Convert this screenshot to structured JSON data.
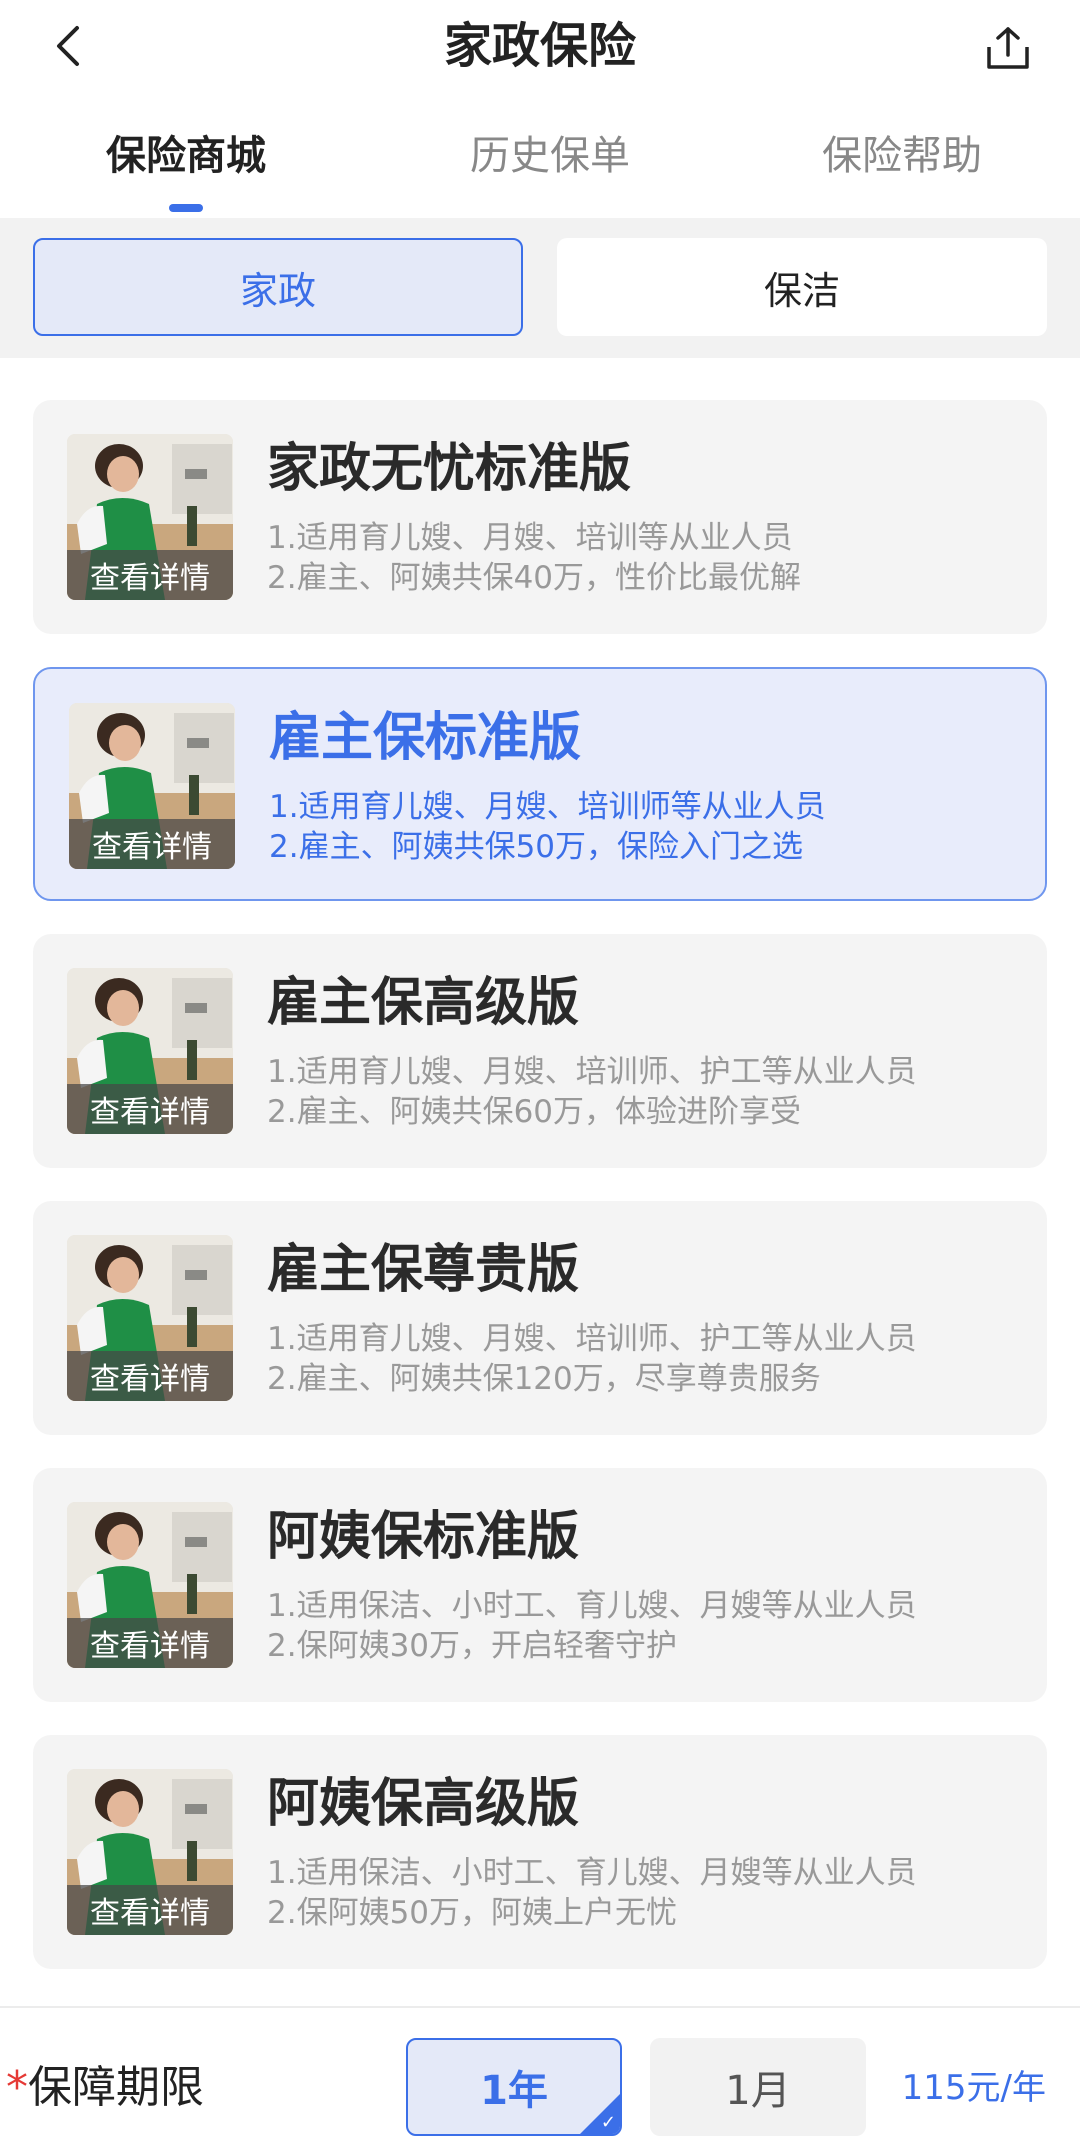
{
  "header": {
    "title": "家政保险"
  },
  "tabs": [
    {
      "label": "保险商城",
      "active": true
    },
    {
      "label": "历史保单",
      "active": false
    },
    {
      "label": "保险帮助",
      "active": false
    }
  ],
  "categories": [
    {
      "label": "家政",
      "active": true
    },
    {
      "label": "保洁",
      "active": false
    }
  ],
  "products": [
    {
      "title": "家政无忧标准版",
      "line1": "1.适用育儿嫂、月嫂、培训等从业人员",
      "line2": "2.雇主、阿姨共保40万，性价比最优解",
      "thumb_label": "查看详情",
      "selected": false
    },
    {
      "title": "雇主保标准版",
      "line1": "1.适用育儿嫂、月嫂、培训师等从业人员",
      "line2": "2.雇主、阿姨共保50万，保险入门之选",
      "thumb_label": "查看详情",
      "selected": true
    },
    {
      "title": "雇主保高级版",
      "line1": "1.适用育儿嫂、月嫂、培训师、护工等从业人员",
      "line2": "2.雇主、阿姨共保60万，体验进阶享受",
      "thumb_label": "查看详情",
      "selected": false
    },
    {
      "title": "雇主保尊贵版",
      "line1": "1.适用育儿嫂、月嫂、培训师、护工等从业人员",
      "line2": "2.雇主、阿姨共保120万，尽享尊贵服务",
      "thumb_label": "查看详情",
      "selected": false
    },
    {
      "title": "阿姨保标准版",
      "line1": "1.适用保洁、小时工、育儿嫂、月嫂等从业人员",
      "line2": "2.保阿姨30万，开启轻奢守护",
      "thumb_label": "查看详情",
      "selected": false
    },
    {
      "title": "阿姨保高级版",
      "line1": "1.适用保洁、小时工、育儿嫂、月嫂等从业人员",
      "line2": "2.保阿姨50万，阿姨上户无忧",
      "thumb_label": "查看详情",
      "selected": false
    }
  ],
  "footer": {
    "required_mark": "*",
    "period_label": "保障期限",
    "options": [
      {
        "label": "1年",
        "active": true
      },
      {
        "label": "1月",
        "active": false
      }
    ],
    "check_mark": "✓",
    "price": "115元/年"
  },
  "colors": {
    "accent": "#3b6fe8",
    "selected_bg": "#e8ecfb",
    "card_bg": "#f4f4f4"
  }
}
